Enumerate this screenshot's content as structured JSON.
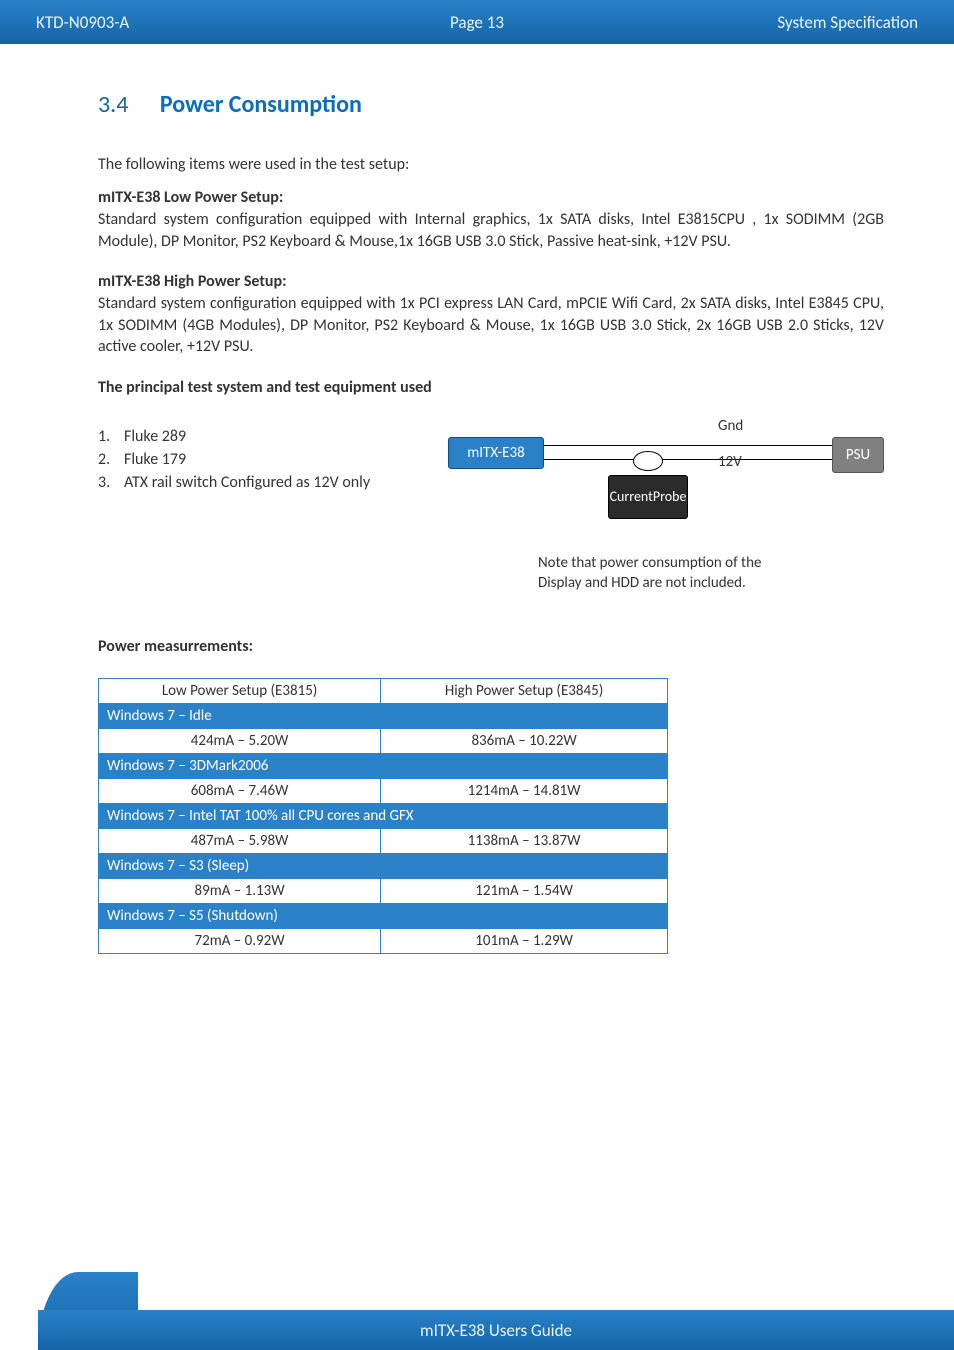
{
  "header": {
    "left": "KTD-N0903-A",
    "center": "Page 13",
    "right": "System Specification"
  },
  "section": {
    "number": "3.4",
    "title": "Power Consumption"
  },
  "intro": "The following items were used in the test setup:",
  "low_setup": {
    "head": "mITX-E38 Low Power Setup:",
    "body": "Standard system configuration equipped with Internal graphics, 1x SATA disks, Intel E3815CPU , 1x SODIMM (2GB Module), DP Monitor, PS2 Keyboard & Mouse,1x 16GB USB 3.0 Stick, Passive heat-sink, +12V PSU."
  },
  "high_setup": {
    "head": "mITX-E38 High Power Setup:",
    "body": "Standard system configuration equipped with 1x PCI express LAN Card, mPCIE Wifi Card, 2x SATA disks, Intel E3845 CPU, 1x SODIMM (4GB Modules), DP Monitor, PS2 Keyboard & Mouse, 1x 16GB USB 3.0 Stick, 2x 16GB USB 2.0 Sticks, 12V active cooler, +12V PSU."
  },
  "equip_head": "The principal test system and test equipment used",
  "equip": [
    "Fluke 289",
    "Fluke 179",
    "ATX rail switch Configured as 12V only"
  ],
  "diagram": {
    "mitx": "mITX-E38",
    "psu": "PSU",
    "probe_l1": "Current",
    "probe_l2": "Probe",
    "gnd": "Gnd",
    "v12": "12V"
  },
  "note_l1": "Note that power consumption of the",
  "note_l2": "Display and HDD are not included.",
  "meas_head": "Power measurrements:",
  "table": {
    "col1": "Low Power Setup (E3815)",
    "col2": "High Power Setup (E3845)",
    "rows": [
      {
        "band": "Windows 7 – Idle"
      },
      {
        "c1": "424mA – 5.20W",
        "c2": "836mA – 10.22W"
      },
      {
        "band": "Windows 7 – 3DMark2006"
      },
      {
        "c1": "608mA – 7.46W",
        "c2": "1214mA – 14.81W"
      },
      {
        "band": "Windows 7 – Intel TAT 100% all CPU cores and GFX"
      },
      {
        "c1": "487mA – 5.98W",
        "c2": "1138mA – 13.87W"
      },
      {
        "band": "Windows 7 – S3 (Sleep)"
      },
      {
        "c1": "89mA – 1.13W",
        "c2": "121mA – 1.54W"
      },
      {
        "band": "Windows 7 – S5 (Shutdown)"
      },
      {
        "c1": "72mA – 0.92W",
        "c2": "101mA – 1.29W"
      }
    ]
  },
  "footer": "mITX-E38 Users Guide"
}
